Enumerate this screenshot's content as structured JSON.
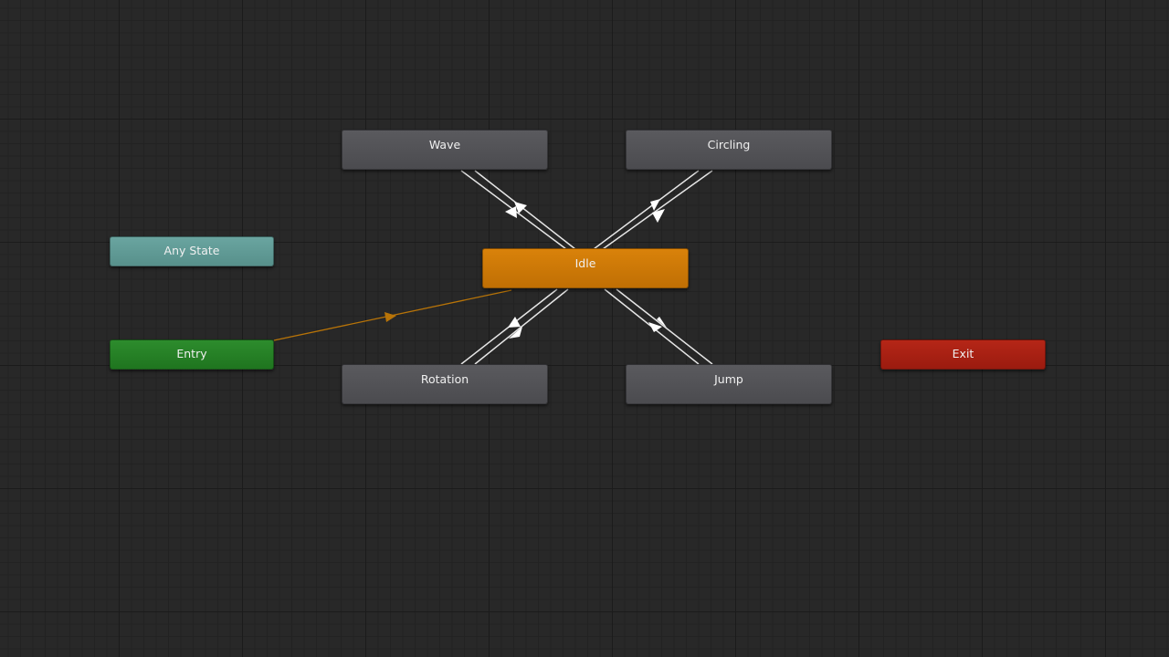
{
  "states": {
    "wave": "Wave",
    "circling": "Circling",
    "idle": "Idle",
    "any_state": "Any State",
    "entry": "Entry",
    "exit": "Exit",
    "rotation": "Rotation",
    "jump": "Jump"
  },
  "colors": {
    "regular_state": "#515155",
    "default_state": "#cc7906",
    "any_state": "#609b96",
    "entry_state": "#267f26",
    "exit_state": "#a82114",
    "transition": "#e8e8e8",
    "entry_transition": "#b87408"
  },
  "transitions": [
    {
      "from": "Wave",
      "to": "Idle"
    },
    {
      "from": "Idle",
      "to": "Wave"
    },
    {
      "from": "Circling",
      "to": "Idle"
    },
    {
      "from": "Idle",
      "to": "Circling"
    },
    {
      "from": "Rotation",
      "to": "Idle"
    },
    {
      "from": "Idle",
      "to": "Rotation"
    },
    {
      "from": "Jump",
      "to": "Idle"
    },
    {
      "from": "Idle",
      "to": "Jump"
    },
    {
      "from": "Entry",
      "to": "Idle"
    }
  ]
}
